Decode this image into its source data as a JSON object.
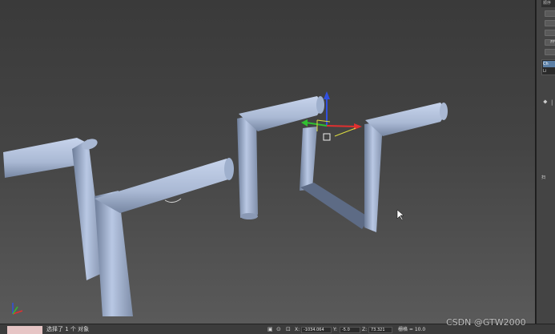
{
  "command_panel": {
    "tab_label": "顺序",
    "button_labels": [
      "",
      "",
      "",
      "FF",
      ""
    ],
    "modifier_items": [
      "Ch",
      "Li"
    ],
    "rollout_label": "扫",
    "stack_tool_labels": [
      "⯁",
      "|"
    ]
  },
  "status_bar": {
    "selection_text": "选择了 1 个 对象",
    "x_label": "X:",
    "x_value": "-1034.064",
    "y_label": "Y:",
    "y_value": "-5.0",
    "z_label": "Z:",
    "z_value": "73.321",
    "grid_label": "栅格 = 10.0",
    "colors": {
      "selection_swatch": "#e6c5c5"
    }
  },
  "viewport": {
    "axis_colors": {
      "x": "#e03030",
      "y": "#30c030",
      "z": "#3050e0"
    }
  },
  "watermark": "CSDN @GTW2000"
}
